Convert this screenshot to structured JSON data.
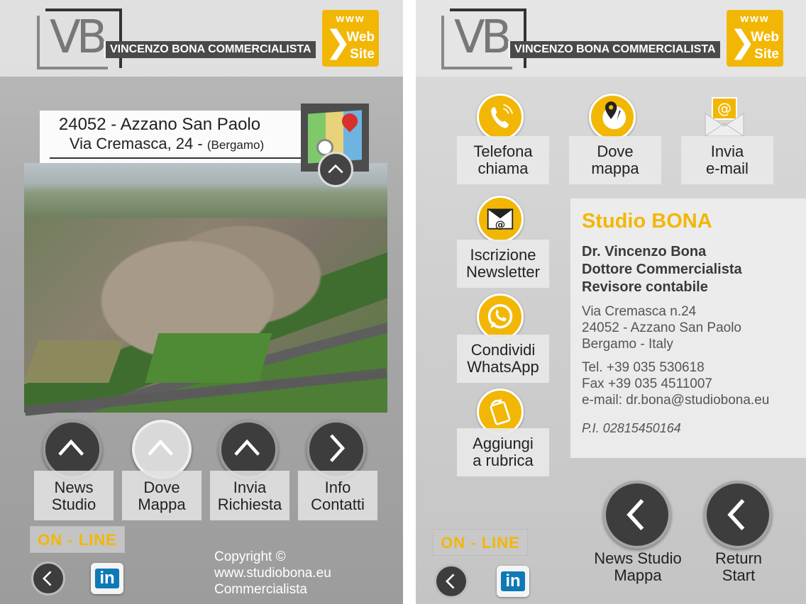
{
  "header": {
    "logo_letters": "VB",
    "company_name": "VINCENZO BONA COMMERCIALISTA",
    "web_badge": {
      "www": "www",
      "line1": "Web",
      "line2": "Site"
    }
  },
  "left": {
    "address": {
      "line1": "24052 - Azzano San Paolo",
      "line2": "Via Cremasca, 24 -",
      "province": "(Bergamo)"
    },
    "nav": [
      {
        "line1": "News",
        "line2": "Studio"
      },
      {
        "line1": "Dove",
        "line2": "Mappa"
      },
      {
        "line1": "Invia",
        "line2": "Richiesta"
      },
      {
        "line1": "Info",
        "line2": "Contatti"
      }
    ],
    "online_label": "ON - LINE",
    "linkedin": "in",
    "copyright": {
      "line1": "Copyright ©",
      "line2": "www.studiobona.eu",
      "line3": "Commercialista"
    }
  },
  "right": {
    "actions": [
      {
        "line1": "Telefona",
        "line2": "chiama"
      },
      {
        "line1": "Dove",
        "line2": "mappa"
      },
      {
        "line1": "Invia",
        "line2": "e-mail"
      },
      {
        "line1": "Iscrizione",
        "line2": "Newsletter"
      },
      {
        "line1": "Condividi",
        "line2": "WhatsApp"
      },
      {
        "line1": "Aggiungi",
        "line2": "a rubrica"
      }
    ],
    "info": {
      "title": "Studio BONA",
      "name": "Dr. Vincenzo Bona",
      "role1": "Dottore Commercialista",
      "role2": "Revisore contabile",
      "addr1": "Via Cremasca n.24",
      "addr2": "24052 - Azzano San Paolo",
      "addr3": "Bergamo  - Italy",
      "tel": "Tel. +39 035 530618",
      "fax": "Fax +39 035 4511007",
      "email": "e-mail: dr.bona@studiobona.eu",
      "pi": "P.I. 02815450164"
    },
    "online_label": "ON - LINE",
    "linkedin": "in",
    "bottom_nav": [
      {
        "line1": "News Studio",
        "line2": "Mappa"
      },
      {
        "line1": "Return",
        "line2": "Start"
      }
    ]
  },
  "colors": {
    "accent": "#f2b705",
    "dark": "#3d3d3d",
    "linkedin": "#0f79b6"
  }
}
